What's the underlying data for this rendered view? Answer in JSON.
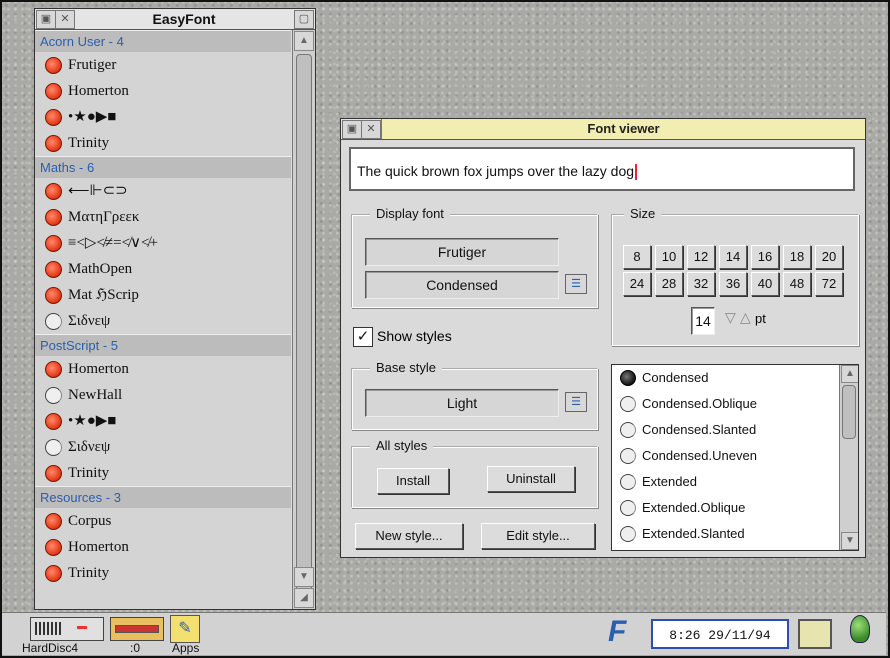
{
  "easyfont": {
    "title": "EasyFont",
    "groups": [
      {
        "label": "Acorn User - 4",
        "items": [
          {
            "label": "Frutiger",
            "selected": true
          },
          {
            "label": "Homerton",
            "selected": true
          },
          {
            "label": "•★●▶■",
            "selected": true
          },
          {
            "label": "Trinity",
            "selected": true
          }
        ]
      },
      {
        "label": "Maths - 6",
        "items": [
          {
            "label": "⟵⊩⊂⊃",
            "selected": true
          },
          {
            "label": "ΜατηΓρεεκ",
            "selected": true
          },
          {
            "label": "≡<▷≮≠=≮∨≮+",
            "selected": true
          },
          {
            "label": "MathOpen",
            "selected": true
          },
          {
            "label": "Mat ℌScrip",
            "selected": true
          },
          {
            "label": "Σιδνεψ",
            "selected": false
          }
        ]
      },
      {
        "label": "PostScript - 5",
        "items": [
          {
            "label": "Homerton",
            "selected": true
          },
          {
            "label": "NewHall",
            "selected": false
          },
          {
            "label": "•★●▶■",
            "selected": true
          },
          {
            "label": "Σιδνεψ",
            "selected": false
          },
          {
            "label": "Trinity",
            "selected": true
          }
        ]
      },
      {
        "label": "Resources - 3",
        "items": [
          {
            "label": "Corpus",
            "selected": true
          },
          {
            "label": "Homerton",
            "selected": true
          },
          {
            "label": "Trinity",
            "selected": true
          }
        ]
      }
    ]
  },
  "viewer": {
    "title": "Font viewer",
    "sample_text": "The quick brown fox jumps over the lazy dog",
    "display_font": {
      "label": "Display font",
      "font": "Frutiger",
      "style": "Condensed"
    },
    "size": {
      "label": "Size",
      "row1": [
        "8",
        "10",
        "12",
        "14",
        "16",
        "18",
        "20"
      ],
      "row2": [
        "24",
        "28",
        "32",
        "36",
        "40",
        "48",
        "72"
      ],
      "current": "14",
      "unit": "pt"
    },
    "show_styles": {
      "label": "Show styles",
      "checked": true
    },
    "base_style": {
      "label": "Base style",
      "value": "Light"
    },
    "all_styles": {
      "label": "All styles",
      "install": "Install",
      "uninstall": "Uninstall"
    },
    "new_style": "New style...",
    "edit_style": "Edit style...",
    "styles": [
      {
        "label": "Condensed",
        "selected": true
      },
      {
        "label": "Condensed.Oblique",
        "selected": false
      },
      {
        "label": "Condensed.Slanted",
        "selected": false
      },
      {
        "label": "Condensed.Uneven",
        "selected": false
      },
      {
        "label": "Extended",
        "selected": false
      },
      {
        "label": "Extended.Oblique",
        "selected": false
      },
      {
        "label": "Extended.Slanted",
        "selected": false
      }
    ]
  },
  "iconbar": {
    "harddisc_label": "HardDisc4",
    "ram_label": ":0",
    "apps_label": "Apps",
    "app_letter": "F",
    "clock": "8:26 29/11/94"
  },
  "colors": {
    "accent_blue": "#2a5fb0",
    "radio_red": "#e8401c",
    "title_yellow": "#f2edb0"
  }
}
